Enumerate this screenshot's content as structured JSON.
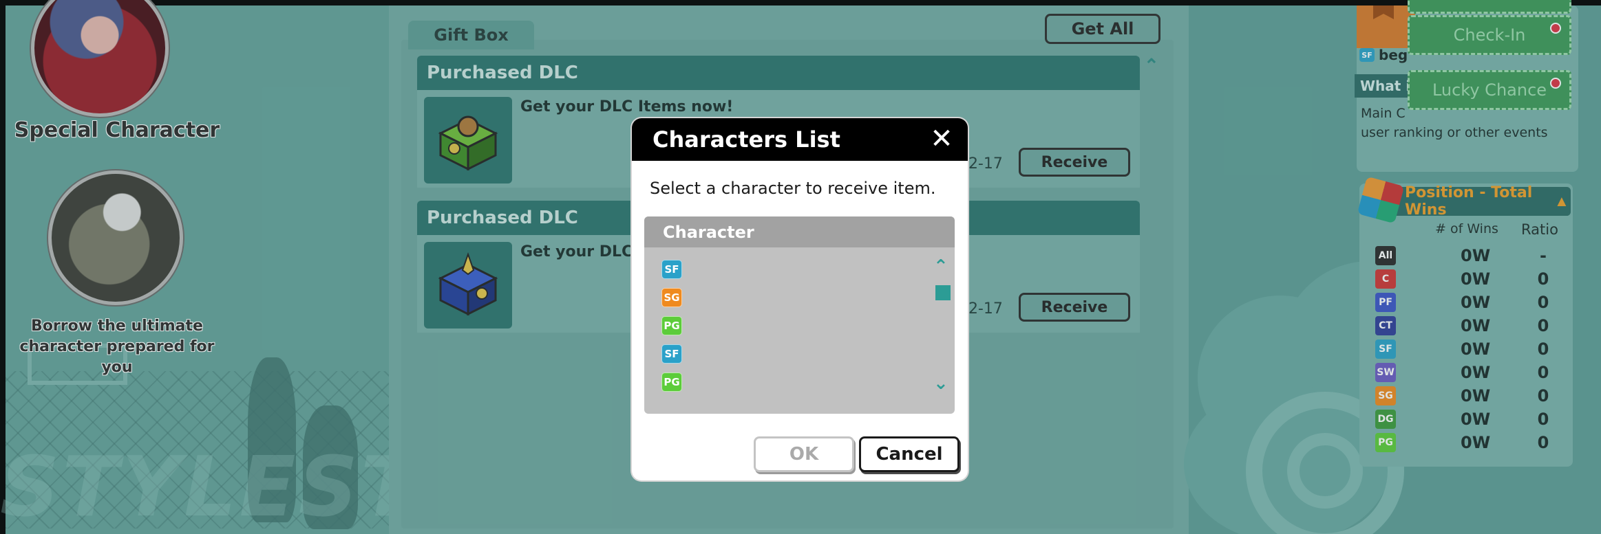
{
  "left_panel": {
    "special_character_label": "Special Character",
    "borrow_label_line1": "Borrow the ultimate",
    "borrow_label_line2": "character prepared for you"
  },
  "gift_box": {
    "tab_label": "Gift Box",
    "get_all_label": "Get All",
    "items": [
      {
        "header": "Purchased DLC",
        "text": "Get your DLC Items now!",
        "date": "-2-17",
        "button": "Receive"
      },
      {
        "header": "Purchased DLC",
        "text": "Get your DLC Ite",
        "date": "-2-17",
        "button": "Receive"
      }
    ]
  },
  "right_panel": {
    "check_in_label": "Check-In",
    "lucky_chance_label": "Lucky Chance",
    "beg_text": "beg",
    "beg_badge": "SF",
    "what_label": "What i",
    "main_text": "Main C",
    "ranking_text": "user ranking or other events",
    "stats": {
      "title": "Position - Total Wins",
      "col_wins": "# of Wins",
      "col_ratio": "Ratio",
      "rows": [
        {
          "pos": "All",
          "color": "#2a2a2a",
          "wins": "0W",
          "ratio": "-"
        },
        {
          "pos": "C",
          "color": "#d03535",
          "wins": "0W",
          "ratio": "0"
        },
        {
          "pos": "PF",
          "color": "#3b55c9",
          "wins": "0W",
          "ratio": "0"
        },
        {
          "pos": "CT",
          "color": "#2f3e9a",
          "wins": "0W",
          "ratio": "0"
        },
        {
          "pos": "SF",
          "color": "#2aa1c9",
          "wins": "0W",
          "ratio": "0"
        },
        {
          "pos": "SW",
          "color": "#6b5bc4",
          "wins": "0W",
          "ratio": "0"
        },
        {
          "pos": "SG",
          "color": "#ef8a1f",
          "wins": "0W",
          "ratio": "0"
        },
        {
          "pos": "DG",
          "color": "#3c9b3c",
          "wins": "0W",
          "ratio": "0"
        },
        {
          "pos": "PG",
          "color": "#5ccc3a",
          "wins": "0W",
          "ratio": "0"
        }
      ]
    }
  },
  "modal": {
    "title": "Characters List",
    "close_icon": "close-icon",
    "instruction": "Select a character to receive item.",
    "list_header": "Character",
    "characters": [
      {
        "pos": "SF",
        "color": "#2aa1c9"
      },
      {
        "pos": "SG",
        "color": "#ef8a1f"
      },
      {
        "pos": "PG",
        "color": "#5ccc3a"
      },
      {
        "pos": "SF",
        "color": "#2aa1c9"
      },
      {
        "pos": "PG",
        "color": "#5ccc3a"
      }
    ],
    "ok_label": "OK",
    "cancel_label": "Cancel"
  }
}
